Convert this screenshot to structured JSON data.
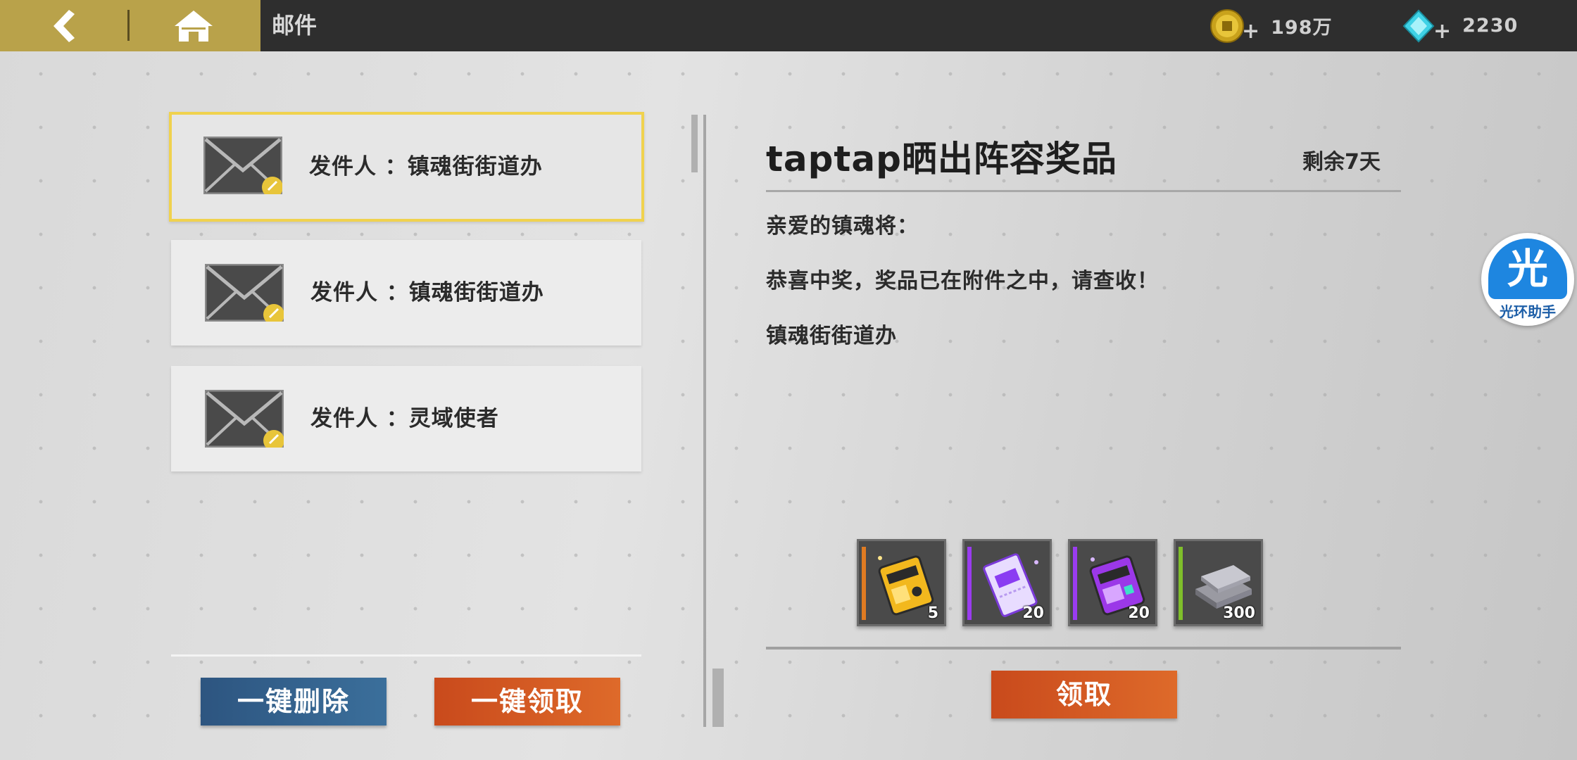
{
  "header": {
    "title": "邮件",
    "gold": {
      "icon": "coin-icon",
      "value": "198万"
    },
    "gems": {
      "icon": "diamond-icon",
      "value": "2230"
    },
    "plus": "+"
  },
  "mail_list": [
    {
      "sender_prefix": "发件人 ：",
      "sender": "镇魂街街道办",
      "selected": true,
      "attachment_icon": "link-icon"
    },
    {
      "sender_prefix": "发件人 ：",
      "sender": "镇魂街街道办",
      "selected": false,
      "attachment_icon": "link-icon"
    },
    {
      "sender_prefix": "发件人 ：",
      "sender": "灵域使者",
      "selected": false,
      "attachment_icon": "link-icon"
    }
  ],
  "buttons": {
    "delete_all": "一键删除",
    "claim_all": "一键领取",
    "claim": "领取"
  },
  "mail_detail": {
    "title": "taptap晒出阵容奖品",
    "remaining": "剩余7天",
    "greeting": "亲爱的镇魂将：",
    "body": "恭喜中奖，奖品已在附件之中，请查收！",
    "signature": "镇魂街街道办"
  },
  "rewards": [
    {
      "name": "gold-card-icon",
      "qty": "5",
      "rarity_color": "#e07b22"
    },
    {
      "name": "purple-ticket-icon",
      "qty": "20",
      "rarity_color": "#9a3cf0"
    },
    {
      "name": "purple-card-icon",
      "qty": "20",
      "rarity_color": "#9a3cf0"
    },
    {
      "name": "silver-ingot-icon",
      "qty": "300",
      "rarity_color": "#7fbf2a"
    }
  ],
  "helper": {
    "glyph": "光",
    "label": "光环助手"
  }
}
